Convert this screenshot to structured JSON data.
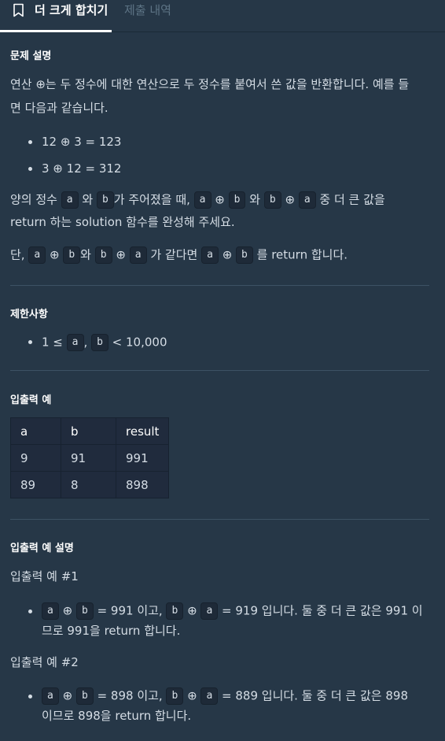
{
  "tabs": {
    "active": "더 크게 합치기",
    "inactive": "제출 내역"
  },
  "description": {
    "heading": "문제 설명",
    "intro_line1": "연산 ⊕는 두 정수에 대한 연산으로 두 정수를 붙여서 쓴 값을 반환합니다. 예를 들",
    "intro_line2": "면 다음과 같습니다.",
    "examples": [
      "12 ⊕ 3 = 123",
      "3 ⊕ 12 = 312"
    ],
    "p2_part1": "양의 정수",
    "p2_part2": "와",
    "p2_part3": "가 주어졌을 때,",
    "p2_part4": "와",
    "p2_part5": "중 더 큰 값을",
    "p2_line2": "return 하는 solution 함수를 완성해 주세요.",
    "p3_part1": "단,",
    "p3_part2": "와",
    "p3_part3": "가 같다면",
    "p3_part4": "를 return 합니다.",
    "var_a": "a",
    "var_b": "b",
    "op": "⊕"
  },
  "constraints": {
    "heading": "제한사항",
    "item_prefix": "1 ≤",
    "item_sep": ",",
    "item_suffix": "< 10,000"
  },
  "io_examples": {
    "heading": "입출력 예",
    "columns": [
      "a",
      "b",
      "result"
    ],
    "rows": [
      [
        "9",
        "91",
        "991"
      ],
      [
        "89",
        "8",
        "898"
      ]
    ]
  },
  "io_explanation": {
    "heading": "입출력 예 설명",
    "ex1_title": "입출력 예 #1",
    "ex1_mid1": "= 991 이고,",
    "ex1_mid2": "= 919 입니다. 둘 중 더 큰 값은 991 이",
    "ex1_line2": "므로 991을 return 합니다.",
    "ex2_title": "입출력 예 #2",
    "ex2_mid1": "= 898 이고,",
    "ex2_mid2": "= 889 입니다. 둘 중 더 큰 값은 898",
    "ex2_line2": "이므로 898을 return 합니다."
  }
}
